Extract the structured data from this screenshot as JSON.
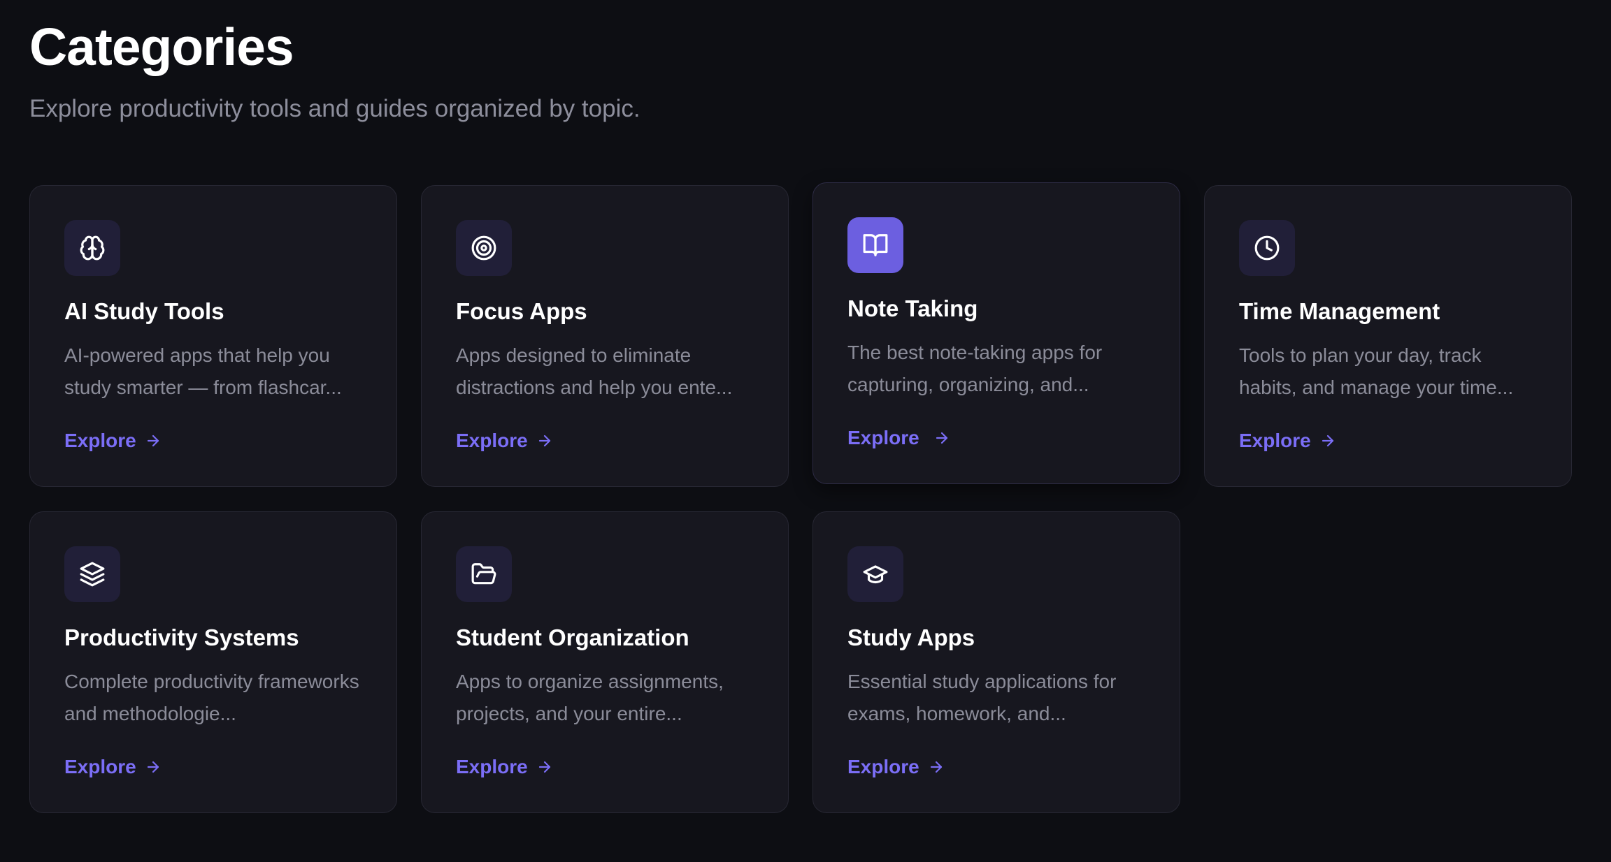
{
  "header": {
    "title": "Categories",
    "subtitle": "Explore productivity tools and guides organized by topic."
  },
  "colors": {
    "background": "#0d0e13",
    "card": "#17171f",
    "accent": "#7b6ef6",
    "icon_bg": "#211f38",
    "icon_bg_active": "#6c5fe0"
  },
  "cards": [
    {
      "title": "AI Study Tools",
      "description": "AI-powered apps that help you study smarter — from flashcar...",
      "link": "Explore",
      "icon": "brain-icon"
    },
    {
      "title": "Focus Apps",
      "description": "Apps designed to eliminate distractions and help you ente...",
      "link": "Explore",
      "icon": "target-icon"
    },
    {
      "title": "Note Taking",
      "description": "The best note-taking apps for capturing, organizing, and...",
      "link": "Explore",
      "icon": "book-open-icon",
      "hovered": true
    },
    {
      "title": "Time Management",
      "description": "Tools to plan your day, track habits, and manage your time...",
      "link": "Explore",
      "icon": "clock-icon"
    },
    {
      "title": "Productivity Systems",
      "description": "Complete productivity frameworks and methodologie...",
      "link": "Explore",
      "icon": "layers-icon"
    },
    {
      "title": "Student Organization",
      "description": "Apps to organize assignments, projects, and your entire...",
      "link": "Explore",
      "icon": "folder-open-icon"
    },
    {
      "title": "Study Apps",
      "description": "Essential study applications for exams, homework, and...",
      "link": "Explore",
      "icon": "graduation-cap-icon"
    }
  ]
}
